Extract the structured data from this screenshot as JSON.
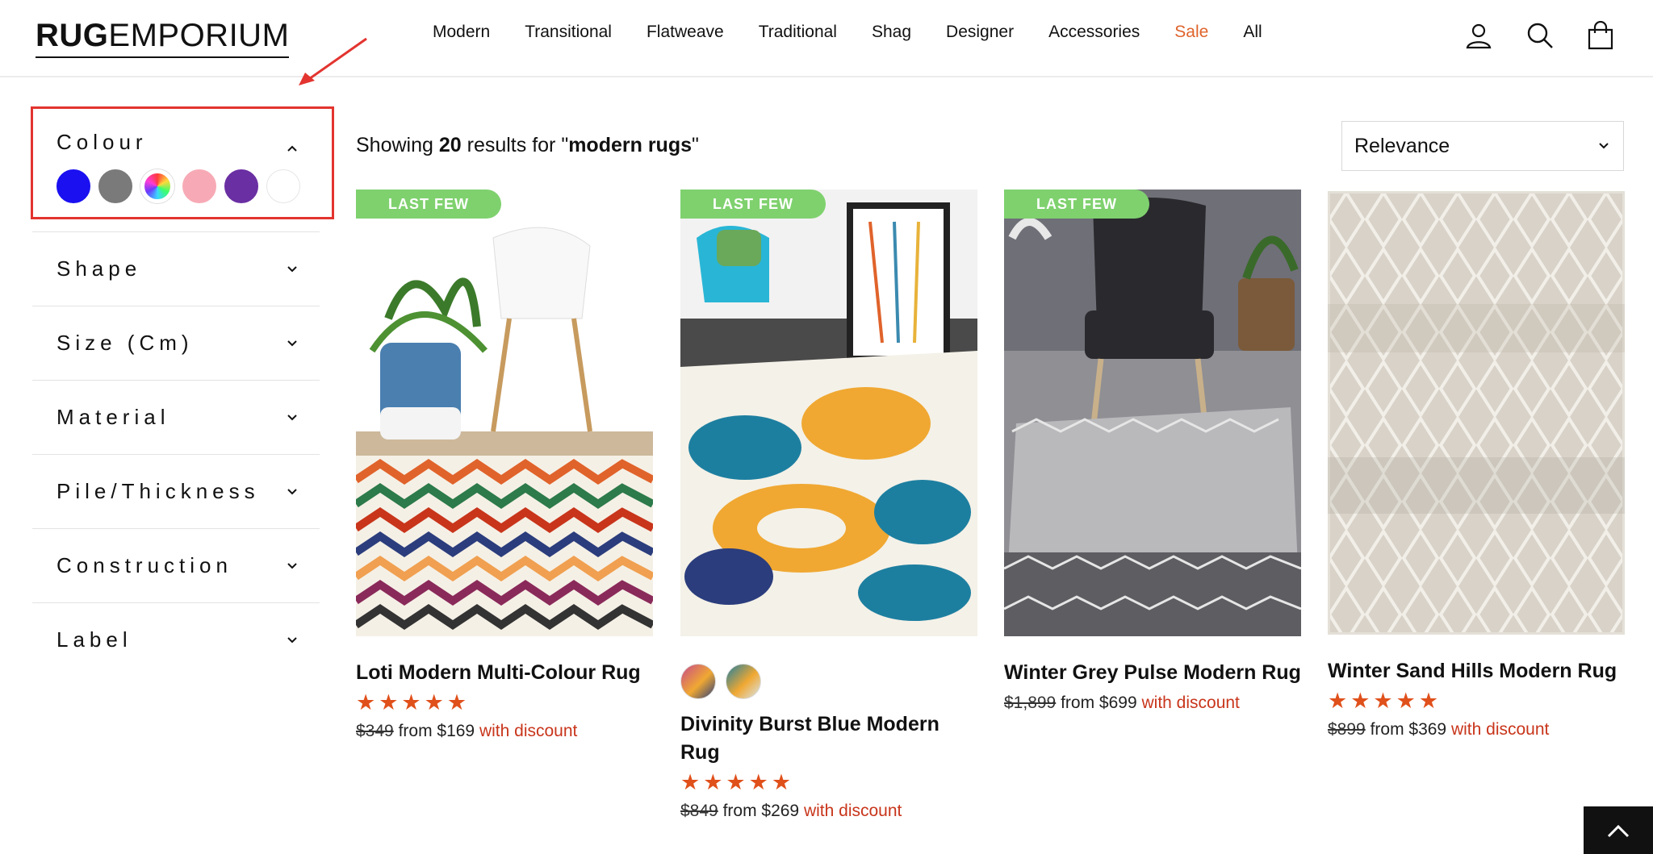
{
  "logo": {
    "bold": "RUG",
    "light": "EMPORIUM"
  },
  "nav": [
    {
      "label": "Modern"
    },
    {
      "label": "Transitional"
    },
    {
      "label": "Flatweave"
    },
    {
      "label": "Traditional"
    },
    {
      "label": "Shag"
    },
    {
      "label": "Designer"
    },
    {
      "label": "Accessories"
    },
    {
      "label": "Sale"
    },
    {
      "label": "All"
    }
  ],
  "header_icons": [
    "account-icon",
    "search-icon",
    "cart-icon"
  ],
  "filters": {
    "colour": {
      "title": "Colour",
      "expanded": true,
      "swatches": [
        {
          "name": "blue",
          "color": "#1a10f0"
        },
        {
          "name": "grey",
          "color": "#7a7a7a"
        },
        {
          "name": "multi",
          "color": "conic"
        },
        {
          "name": "pink",
          "color": "#f7aab5"
        },
        {
          "name": "purple",
          "color": "#6a2fa3"
        },
        {
          "name": "white",
          "color": "#ffffff"
        }
      ]
    },
    "collapsed": [
      {
        "title": "Shape"
      },
      {
        "title": "Size (Cm)"
      },
      {
        "title": "Material"
      },
      {
        "title": "Pile/Thickness"
      },
      {
        "title": "Construction"
      },
      {
        "title": "Label"
      }
    ]
  },
  "results": {
    "prefix": "Showing",
    "count": "20",
    "middle": "results for \"",
    "query": "modern rugs",
    "suffix": "\""
  },
  "sort": {
    "selected": "Relevance"
  },
  "products": [
    {
      "badge": "LAST FEW",
      "name": "Loti Modern Multi-Colour Rug",
      "rating": 5,
      "stars": "★★★★★",
      "was": "$349",
      "from": "from $169",
      "discount": "with discount"
    },
    {
      "badge": "LAST FEW",
      "name": "Divinity Burst Blue Modern Rug",
      "rating": 5,
      "stars": "★★★★★",
      "was": "$849",
      "from": "from $269",
      "discount": "with discount",
      "variants": [
        "pink-multi",
        "blue-multi"
      ]
    },
    {
      "badge": "LAST FEW",
      "name": "Winter Grey Pulse Modern Rug",
      "was": "$1,899",
      "from": "from $699",
      "discount": "with discount"
    },
    {
      "name": "Winter Sand Hills Modern Rug",
      "rating": 5,
      "stars": "★★★★★",
      "was": "$899",
      "from": "from $369",
      "discount": "with discount"
    }
  ],
  "colors": {
    "sale": "#e0632b",
    "badge": "#7fd16e",
    "stars": "#e0501b",
    "discount": "#c8351b",
    "annotation": "#e3342f"
  }
}
